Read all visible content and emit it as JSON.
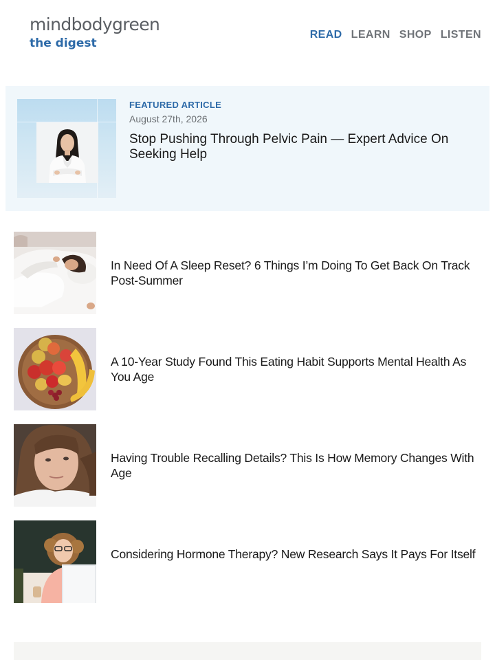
{
  "header": {
    "logo_main": "mindbodygreen",
    "logo_sub": "the digest",
    "nav": [
      "READ",
      "LEARN",
      "SHOP",
      "LISTEN"
    ],
    "active_nav": "READ"
  },
  "featured": {
    "label": "FEATURED ARTICLE",
    "date": "August 27th, 2026",
    "title": "Stop Pushing Through Pelvic Pain — Expert Advice On Seeking Help"
  },
  "articles": [
    {
      "title": "In Need Of A Sleep Reset? 6 Things I’m Doing To Get Back On Track Post-Summer",
      "thumb": "woman-sleeping-photo"
    },
    {
      "title": "A 10-Year Study Found This Eating Habit Supports Mental Health As You Age",
      "thumb": "fruit-bowl-photo"
    },
    {
      "title": "Having Trouble Recalling Details? This Is How Memory Changes With Age",
      "thumb": "woman-portrait-photo"
    },
    {
      "title": "Considering Hormone Therapy? New Research Says It Pays For Itself",
      "thumb": "woman-laptop-photo"
    }
  ],
  "colors": {
    "accent": "#2d6aa8",
    "featured_bg": "#f0f7fb"
  }
}
